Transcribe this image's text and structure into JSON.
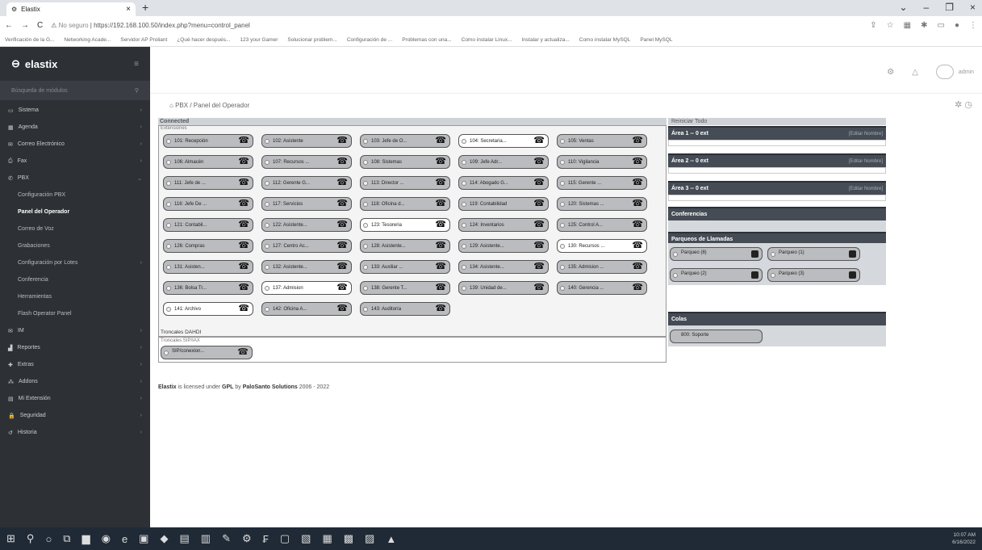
{
  "browser": {
    "tab_title": "Elastix",
    "url_warning": "No seguro",
    "url": "https://192.168.100.50/index.php?menu=control_panel",
    "bookmarks": [
      "Verificación de la G...",
      "Networking Acade...",
      "Servidor AP Proliant",
      "¿Qué hacer después...",
      "123 your Gamer",
      "Solucionar problem...",
      "Configuración de ...",
      "Problemas con una...",
      "Como instalar Linux...",
      "Instalar y actualiza...",
      "Como instalar MySQL",
      "Panel MySQL"
    ]
  },
  "sidebar": {
    "logo": "elastix",
    "search_placeholder": "Búsqueda de módulos",
    "items": [
      {
        "label": "Sistema",
        "icon": "monitor-icon",
        "arrow": "›"
      },
      {
        "label": "Agenda",
        "icon": "calendar-icon",
        "arrow": "›"
      },
      {
        "label": "Correo Electrónico",
        "icon": "mail-icon",
        "arrow": "›"
      },
      {
        "label": "Fax",
        "icon": "fax-icon",
        "arrow": "›"
      },
      {
        "label": "PBX",
        "icon": "phone-icon",
        "arrow": "⌄"
      }
    ],
    "subitems": [
      "Configuración PBX",
      "Panel del Operador",
      "Correo de Voz",
      "Grabaciones",
      "Configuración por Lotes",
      "Conferencia",
      "Herramientas",
      "Flash Operator Panel"
    ],
    "items2": [
      {
        "label": "IM",
        "icon": "chat-icon"
      },
      {
        "label": "Reportes",
        "icon": "chart-icon"
      },
      {
        "label": "Extras",
        "icon": "plus-icon"
      },
      {
        "label": "Addons",
        "icon": "addon-icon"
      },
      {
        "label": "Mi Extensión",
        "icon": "user-icon"
      },
      {
        "label": "Seguridad",
        "icon": "lock-icon"
      },
      {
        "label": "Historia",
        "icon": "history-icon"
      }
    ]
  },
  "topbar": {
    "user": "admin"
  },
  "breadcrumb": {
    "home": "⌂",
    "section": "PBX",
    "page": "Panel del Operador"
  },
  "panel": {
    "connected": "Connected",
    "extensions_label": "Extensiones",
    "extensions": [
      [
        "101: Recepción",
        "102: Asistente",
        "103: Jefe de O...",
        "104: Secretaria...",
        "105: Ventas"
      ],
      [
        "106: Almacén",
        "107: Recursos ...",
        "108: Sistemas",
        "109: Jefe Adr...",
        "110: Vigilancia"
      ],
      [
        "111: Jefe de ...",
        "112: Gerente G...",
        "113: Director ...",
        "114: Abogado G...",
        "115: Gerente ..."
      ],
      [
        "116: Jefe De ...",
        "117: Servicios",
        "118: Oficina d...",
        "119: Contabilidad",
        "120: Sistemas ..."
      ],
      [
        "121: Contabil...",
        "122: Asistente...",
        "123: Tesoreria",
        "124: Inventarios",
        "125: Control A..."
      ],
      [
        "126: Compras",
        "127: Centro Ac...",
        "128: Asistente...",
        "129: Asistente...",
        "130: Recursos ..."
      ],
      [
        "131: Asisten...",
        "132: Asistente...",
        "133: Auxiliar ...",
        "134: Asistente...",
        "135: Admision ..."
      ],
      [
        "136: Bolsa Tr...",
        "137: Admision",
        "138: Gerente T...",
        "139: Unidad de...",
        "140: Gerencia ..."
      ],
      [
        "141: Archivo",
        "142: Oficina A...",
        "143: Auditoría"
      ]
    ],
    "troncal_label": "Troncales DAHDI",
    "sip_label": "Troncales SIP/IAX",
    "sip_trunk": "SIP/conexion..."
  },
  "right": {
    "reset": "Reiniciar Todo",
    "areas": [
      {
        "title": "Área 1 -- 0 ext",
        "edit": "[Editar Nombre]"
      },
      {
        "title": "Área 2 -- 0 ext",
        "edit": "[Editar Nombre]"
      },
      {
        "title": "Área 3 -- 0 ext",
        "edit": "[Editar Nombre]"
      }
    ],
    "conferences": "Conferencias",
    "parking_title": "Parqueos de Llamadas",
    "parkings": [
      "Parqueo (8)",
      "Parqueo (1)",
      "Parqueo (2)",
      "Parqueo (3)"
    ],
    "queues": "Colas",
    "queue_item": "800: Soporte"
  },
  "footer": {
    "brand": "Elastix",
    "text": "is licensed under",
    "license": "GPL",
    "by": "by",
    "company": "PaloSanto Solutions",
    "years": "2006 - 2022"
  },
  "taskbar": {
    "time": "10:07 AM",
    "date": "6/16/2022"
  }
}
